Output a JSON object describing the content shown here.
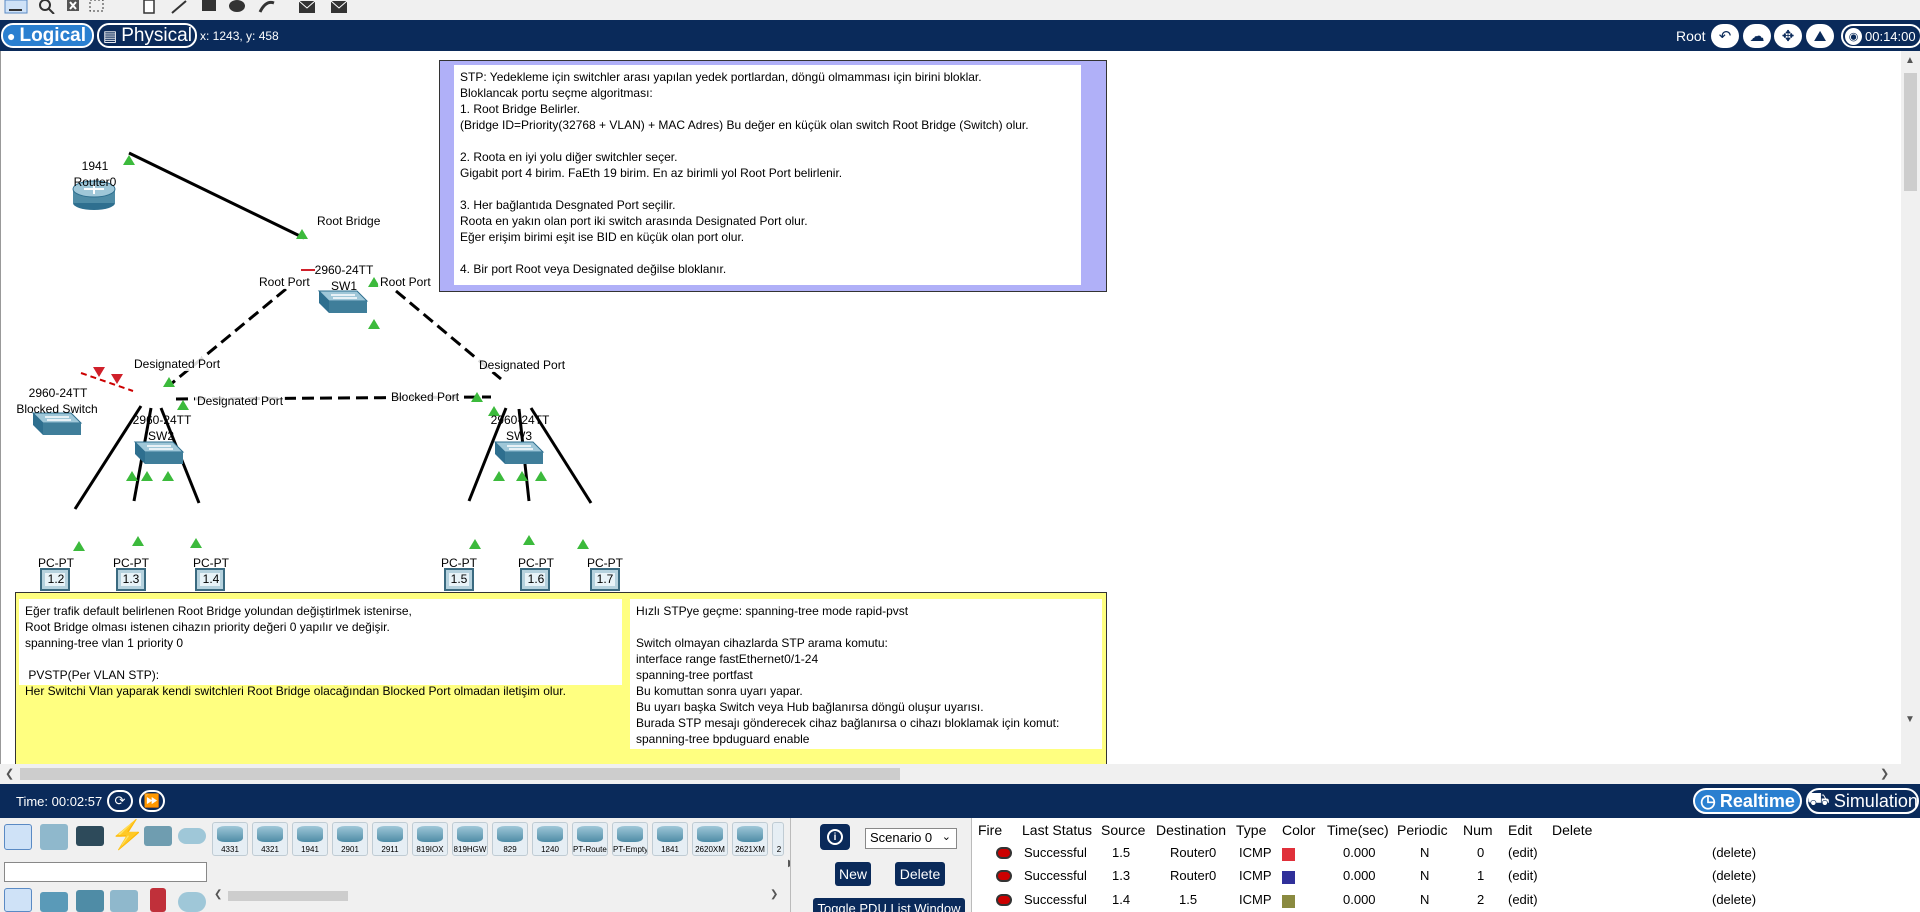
{
  "mode_bar": {
    "logical_label": "Logical",
    "physical_label": "Physical",
    "coords": "x: 1243, y: 458",
    "root_label": "Root",
    "clock": "00:14:00"
  },
  "topology": {
    "router": {
      "model": "1941",
      "name": "Router0"
    },
    "sw1": {
      "model": "2960-24TT",
      "name": "SW1",
      "title": "Root Bridge"
    },
    "sw2": {
      "model": "2960-24TT",
      "name": "SW2"
    },
    "sw3": {
      "model": "2960-24TT",
      "name": "SW3"
    },
    "blocked_switch": {
      "model": "2960-24TT",
      "name": "Blocked Switch"
    },
    "port_labels": {
      "sw1_left": "Root Port",
      "sw1_right": "Root Port",
      "sw2_top": "Designated Port",
      "sw2_right": "Designated Port",
      "sw3_top": "Designated Port",
      "sw3_left": "Blocked Port"
    },
    "pcs": [
      {
        "model": "PC-PT",
        "name": "1.2"
      },
      {
        "model": "PC-PT",
        "name": "1.3"
      },
      {
        "model": "PC-PT",
        "name": "1.4"
      },
      {
        "model": "PC-PT",
        "name": "1.5"
      },
      {
        "model": "PC-PT",
        "name": "1.6"
      },
      {
        "model": "PC-PT",
        "name": "1.7"
      }
    ]
  },
  "notes": {
    "stp": "STP: Yedekleme için switchler arası yapılan yedek portlardan, döngü olmamması için birini bloklar.\nBloklancak portu seçme algoritması:\n1. Root Bridge Belirler.\n(Bridge ID=Priority(32768 + VLAN) + MAC Adres) Bu değer en küçük olan switch Root Bridge (Switch) olur.\n\n2. Roota en iyi yolu diğer switchler seçer.\nGigabit port 4 birim. FaEth 19 birim. En az birimli yol Root Port belirlenir.\n\n3. Her bağlantıda Desgnated Port seçilir.\nRoota en yakın olan port iki switch arasında Designated Port olur.\nEğer erişim birimi eşit ise BID en küçük olan port olur.\n\n4. Bir port Root veya Designated değilse bloklanır.",
    "left": "Eğer trafik default belirlenen Root Bridge yolundan değiştirlmek istenirse,\nRoot Bridge olması istenen cihazın priority değeri 0 yapılır ve değişir.\nspanning-tree vlan 1 priority 0\n\n PVSTP(Per VLAN STP):\nHer Switchi Vlan yaparak kendi switchleri Root Bridge olacağından Blocked Port olmadan iletişim olur.",
    "right": "Hızlı STPye geçme: spanning-tree mode rapid-pvst\n\nSwitch olmayan cihazlarda STP arama komutu:\ninterface range fastEthernet0/1-24\nspanning-tree portfast\nBu komuttan sonra uyarı yapar.\nBu uyarı başka Switch veya Hub bağlanırsa döngü oluşur uyarısı.\nBurada STP mesajı gönderecek cihaz bağlanırsa o cihazı bloklamak için komut:\nspanning-tree bpduguard enable"
  },
  "status_bar": {
    "time": "Time: 00:02:57",
    "realtime_label": "Realtime",
    "simulation_label": "Simulation"
  },
  "device_list": [
    "4331",
    "4321",
    "1941",
    "2901",
    "2911",
    "819IOX",
    "819HGW",
    "829",
    "1240",
    "PT-Router",
    "PT-Empty",
    "1841",
    "2620XM",
    "2621XM",
    "2"
  ],
  "scenario": {
    "selected": "Scenario 0",
    "new_label": "New",
    "delete_label": "Delete",
    "toggle_label": "Toggle PDU List Window"
  },
  "pdu_table": {
    "headers": [
      "Fire",
      "Last Status",
      "Source",
      "Destination",
      "Type",
      "Color",
      "Time(sec)",
      "Periodic",
      "Num",
      "Edit",
      "Delete"
    ],
    "rows": [
      {
        "status": "Successful",
        "source": "1.5",
        "destination": "Router0",
        "type": "ICMP",
        "color": "#e0303a",
        "time": "0.000",
        "periodic": "N",
        "num": "0",
        "edit": "(edit)",
        "delete": "(delete)"
      },
      {
        "status": "Successful",
        "source": "1.3",
        "destination": "Router0",
        "type": "ICMP",
        "color": "#30309a",
        "time": "0.000",
        "periodic": "N",
        "num": "1",
        "edit": "(edit)",
        "delete": "(delete)"
      },
      {
        "status": "Successful",
        "source": "1.4",
        "destination": "1.5",
        "type": "ICMP",
        "color": "#8a8a40",
        "time": "0.000",
        "periodic": "N",
        "num": "2",
        "edit": "(edit)",
        "delete": "(delete)"
      }
    ]
  }
}
